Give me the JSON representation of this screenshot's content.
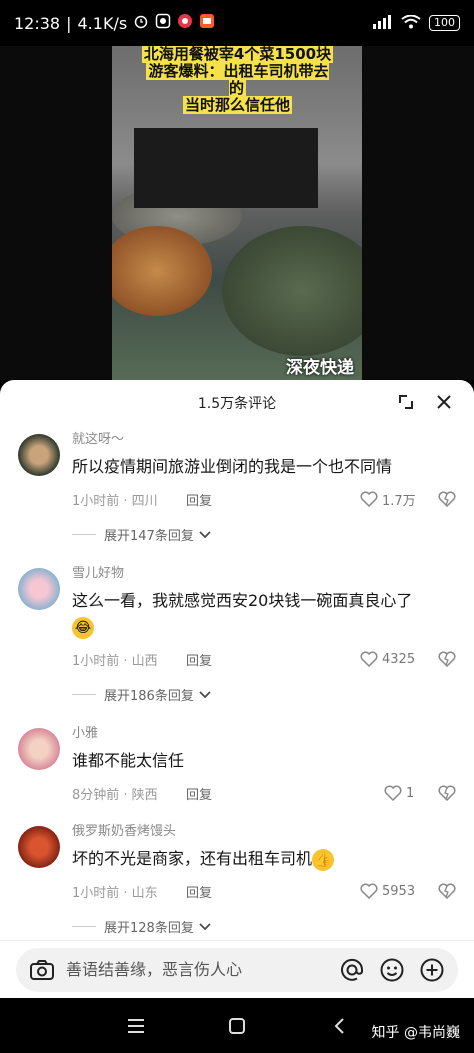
{
  "status": {
    "time": "12:38",
    "speed": "4.1K/s",
    "battery": "100",
    "network": "HD"
  },
  "video": {
    "headline_line1": "北海用餐被宰4个菜1500块",
    "headline_line2": "游客爆料：出租车司机带去的",
    "headline_line3": "当时那么信任他",
    "watermark": "深夜快递"
  },
  "sheet": {
    "title": "1.5万条评论"
  },
  "comments": [
    {
      "name": "就这呀～",
      "text": "所以疫情期间旅游业倒闭的我是一个也不同情",
      "time": "1小时前 · 四川",
      "reply": "回复",
      "likes": "1.7万",
      "expand": "展开147条回复",
      "avatar_color": "#3a4a3a"
    },
    {
      "name": "雪儿好物",
      "text": "这么一看，我就感觉西安20块钱一碗面真良心了",
      "emoji": "😂",
      "time": "1小时前 · 山西",
      "reply": "回复",
      "likes": "4325",
      "expand": "展开186条回复",
      "avatar_color": "#9fb6c8"
    },
    {
      "name": "小雅",
      "text": "谁都不能太信任",
      "time": "8分钟前 · 陕西",
      "reply": "回复",
      "likes": "1",
      "avatar_color": "#e7c1b8"
    },
    {
      "name": "俄罗斯奶香烤馒头",
      "text": "坏的不光是商家，还有出租车司机",
      "emoji": "👍",
      "time": "1小时前 · 山东",
      "reply": "回复",
      "likes": "5953",
      "expand": "展开128条回复",
      "avatar_color": "#b03a22"
    }
  ],
  "input": {
    "placeholder": "善语结善缘，恶言伤人心"
  },
  "nav": {
    "watermark": "知乎 @韦尚巍"
  },
  "icons": [
    "signal-icon",
    "wifi-icon",
    "battery-icon",
    "minimize-icon",
    "close-icon",
    "heart-icon",
    "dislike-heart-icon",
    "chevron-down-icon",
    "camera-icon",
    "at-icon",
    "emoji-icon",
    "plus-icon",
    "menu-icon",
    "home-icon",
    "back-icon"
  ],
  "colors": {
    "sheet_bg": "#ffffff",
    "text": "#161616",
    "meta": "#9a9a9a",
    "highlight": "#f5e14a"
  }
}
